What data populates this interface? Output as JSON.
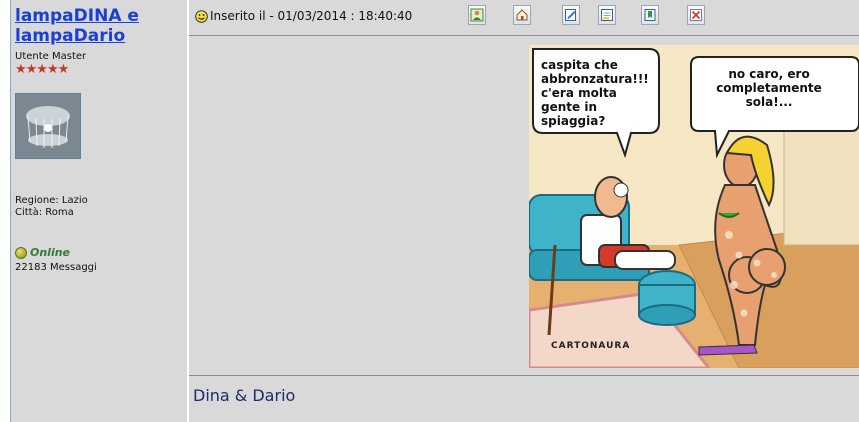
{
  "user": {
    "name": "lampaDINA e lampaDario",
    "rank": "Utente Master",
    "stars": "★★★★★",
    "region": "Regione: Lazio",
    "city": "Città: Roma",
    "status": "Online",
    "messages": "22183 Messaggi"
  },
  "post": {
    "posted": "Inserito il - 01/03/2014 : 18:40:40",
    "toolbar": [
      "profile-icon",
      "home-icon",
      "edit-icon",
      "quote-icon",
      "bookmark-icon",
      "delete-icon"
    ],
    "signature": "Dina & Dario"
  },
  "cartoon": {
    "bubble_left": "caspita che abbronzatura!!! c'era molta gente in spiaggia?",
    "bubble_right": "no caro, ero completamente sola!...",
    "artist": "CARTONAURA"
  },
  "colors": {
    "link": "#1a3fd6",
    "panel": "#d9d9d9",
    "online": "#2e7d32",
    "signature": "#1f2a6d"
  }
}
